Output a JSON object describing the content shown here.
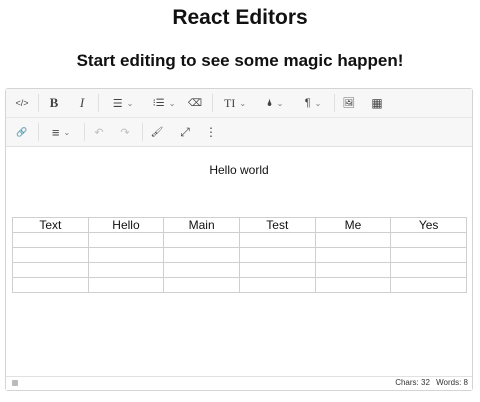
{
  "page": {
    "title": "React Editors",
    "subtitle": "Start editing to see some magic happen!"
  },
  "toolbar": {
    "row1": [
      {
        "name": "code-view-icon",
        "glyph": "</>"
      },
      {
        "name": "bold-icon",
        "glyph": "B"
      },
      {
        "name": "italic-icon",
        "glyph": "I"
      },
      {
        "name": "bullet-list-icon",
        "glyph": "☰"
      },
      {
        "name": "numbered-list-icon",
        "glyph": "⁝☰"
      },
      {
        "name": "eraser-icon",
        "glyph": "⌫"
      },
      {
        "name": "font-size-icon",
        "glyph": "TI"
      },
      {
        "name": "color-drop-icon",
        "glyph": "🌢"
      },
      {
        "name": "paragraph-icon",
        "glyph": "¶"
      },
      {
        "name": "image-icon",
        "glyph": "🖼"
      },
      {
        "name": "table-icon",
        "glyph": "▦"
      }
    ],
    "row2": [
      {
        "name": "link-icon",
        "glyph": "🔗"
      },
      {
        "name": "align-icon",
        "glyph": "≡"
      },
      {
        "name": "undo-icon",
        "glyph": "↶"
      },
      {
        "name": "redo-icon",
        "glyph": "↷"
      },
      {
        "name": "format-painter-icon",
        "glyph": "🖌"
      },
      {
        "name": "fullscreen-icon",
        "glyph": "⤢"
      },
      {
        "name": "more-icon",
        "glyph": "⋮"
      }
    ]
  },
  "content": {
    "hello": "Hello world",
    "table": {
      "header": [
        "Text",
        "Hello",
        "Main",
        "Test",
        "Me",
        "Yes"
      ],
      "empty_rows": 4
    }
  },
  "status": {
    "chars": "Chars: 32",
    "words": "Words: 8"
  }
}
